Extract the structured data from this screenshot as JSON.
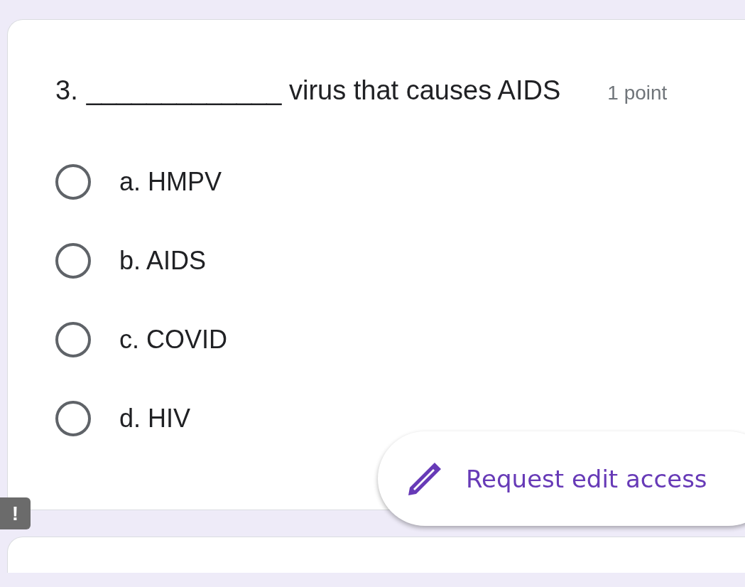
{
  "question": {
    "number": "3.",
    "text": "_____________ virus that causes AIDS",
    "points": "1 point"
  },
  "options": [
    {
      "label": "a. HMPV",
      "selected": false
    },
    {
      "label": "b. AIDS",
      "selected": false
    },
    {
      "label": "c. COVID",
      "selected": false
    },
    {
      "label": "d. HIV",
      "selected": false
    }
  ],
  "fab": {
    "label": "Request edit access"
  },
  "badge": "!"
}
